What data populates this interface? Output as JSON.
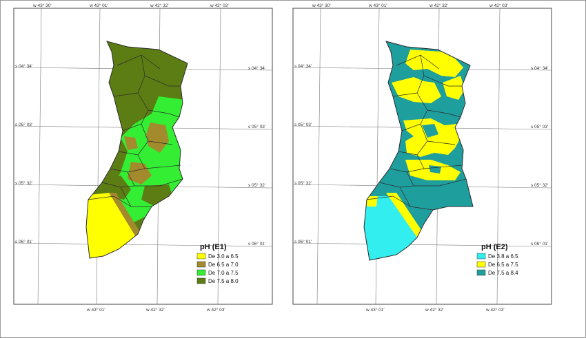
{
  "maps": [
    {
      "id": "E1",
      "legend": {
        "title": "pH (E1)",
        "items": [
          {
            "label": "De 3.0 a 6.5",
            "color": "#ffff00"
          },
          {
            "label": "De 6.5 a 7.0",
            "color": "#a38a2c"
          },
          {
            "label": "De 7.0 a 7.5",
            "color": "#33ee33"
          },
          {
            "label": "De 7.5 a 8.0",
            "color": "#5c7d14"
          }
        ]
      },
      "ticks": {
        "top": [
          "w 43° 30'",
          "w 43° 01'",
          "w 42° 32'",
          "w 42° 03'"
        ],
        "bottom": [
          "w 43° 01'",
          "w 42° 32'",
          "w 42° 03'"
        ],
        "left": [
          "s 04° 34'",
          "s 05° 03'",
          "s 05° 32'",
          "s 06° 01'"
        ],
        "right": [
          "s 04° 34'",
          "s 05° 03'",
          "s 05° 32'",
          "s 06° 01'"
        ]
      }
    },
    {
      "id": "E2",
      "legend": {
        "title": "pH (E2)",
        "items": [
          {
            "label": "De 3.8 a 6.5",
            "color": "#33eeee"
          },
          {
            "label": "De 6.5 a 7.5",
            "color": "#ffff00"
          },
          {
            "label": "De 7.5 a 8.4",
            "color": "#1f9e9e"
          }
        ]
      },
      "ticks": {
        "top": [
          "w 43° 30'",
          "w 43° 01'",
          "w 42° 32'",
          "w 42° 03'"
        ],
        "bottom": [
          "w 43° 01'",
          "w 42° 32'",
          "w 42° 03'"
        ],
        "left": [
          "s 04° 34'",
          "s 05° 03'",
          "s 05° 32'",
          "s 06° 01'"
        ],
        "right": [
          "s 04° 34'",
          "s 05° 03'",
          "s 05° 32'",
          "s 06° 01'"
        ]
      }
    }
  ]
}
